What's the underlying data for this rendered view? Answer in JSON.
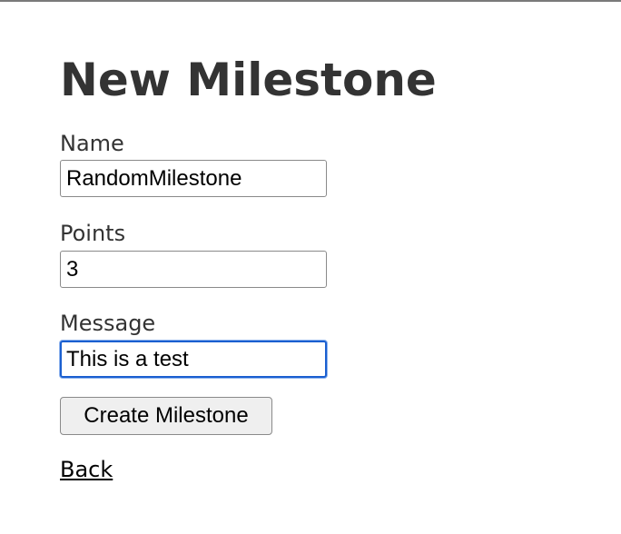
{
  "page": {
    "title": "New Milestone"
  },
  "form": {
    "name": {
      "label": "Name",
      "value": "RandomMilestone"
    },
    "points": {
      "label": "Points",
      "value": "3"
    },
    "message": {
      "label": "Message",
      "value": "This is a test",
      "focused": true
    },
    "submit_label": "Create Milestone"
  },
  "back_link": {
    "label": "Back"
  },
  "colors": {
    "text": "#333333",
    "focus_ring": "#1a5fd0",
    "button_bg": "#efefef"
  }
}
